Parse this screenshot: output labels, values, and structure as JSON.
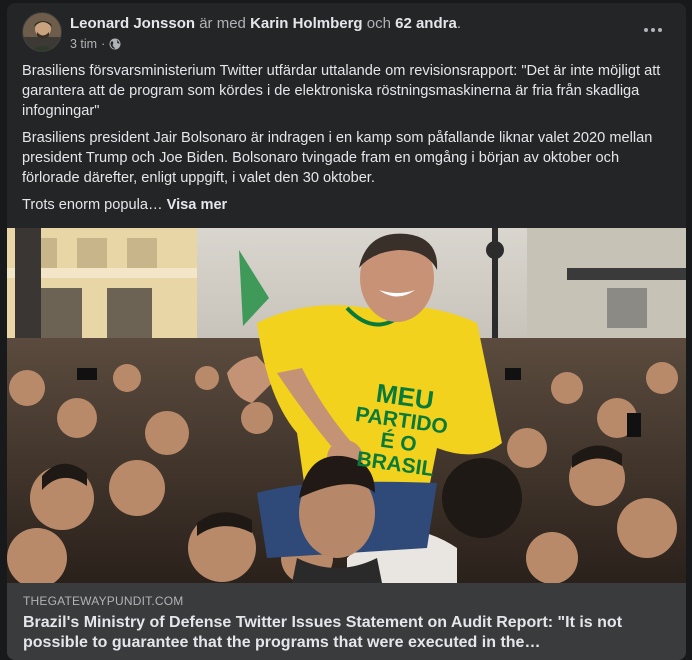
{
  "post": {
    "author": "Leonard Jonsson",
    "with_text": "är med",
    "tagged_person": "Karin Holmberg",
    "and_text": "och",
    "others": "62 andra",
    "period": ".",
    "time": "3 tim",
    "dot": "·",
    "privacy_icon": "globe-icon",
    "more_icon": "more-options-icon",
    "paragraph1": "Brasiliens försvarsministerium Twitter utfärdar uttalande om revisionsrapport: \"Det är inte möjligt att garantera att de program som kördes i de elektroniska röstningsmaskinerna är fria från skadliga infogningar\"",
    "paragraph2": "Brasiliens president Jair Bolsonaro är indragen i en kamp som påfallande liknar valet 2020 mellan president Trump och Joe Biden. Bolsonaro tvingade fram en omgång i början av oktober och förlorade därefter, enligt uppgift, i valet den 30 oktober.",
    "paragraph3": "Trots enorm popula…",
    "see_more": "Visa mer"
  },
  "photo": {
    "shirt_text_line1": "MEU",
    "shirt_text_line2": "PARTIDO",
    "shirt_text_line3": "É O",
    "shirt_text_line4": "BRASIL"
  },
  "link_preview": {
    "domain": "THEGATEWAYPUNDIT.COM",
    "title": "Brazil's Ministry of Defense Twitter Issues Statement on Audit Report: \"It is not possible to guarantee that the programs that were executed in the…"
  },
  "colors": {
    "background": "#18191a",
    "card": "#242526",
    "preview": "#3a3b3c",
    "text_primary": "#e4e6eb",
    "text_secondary": "#b0b3b8",
    "shirt_yellow": "#f3d21d",
    "shirt_green": "#0a7a3a"
  }
}
